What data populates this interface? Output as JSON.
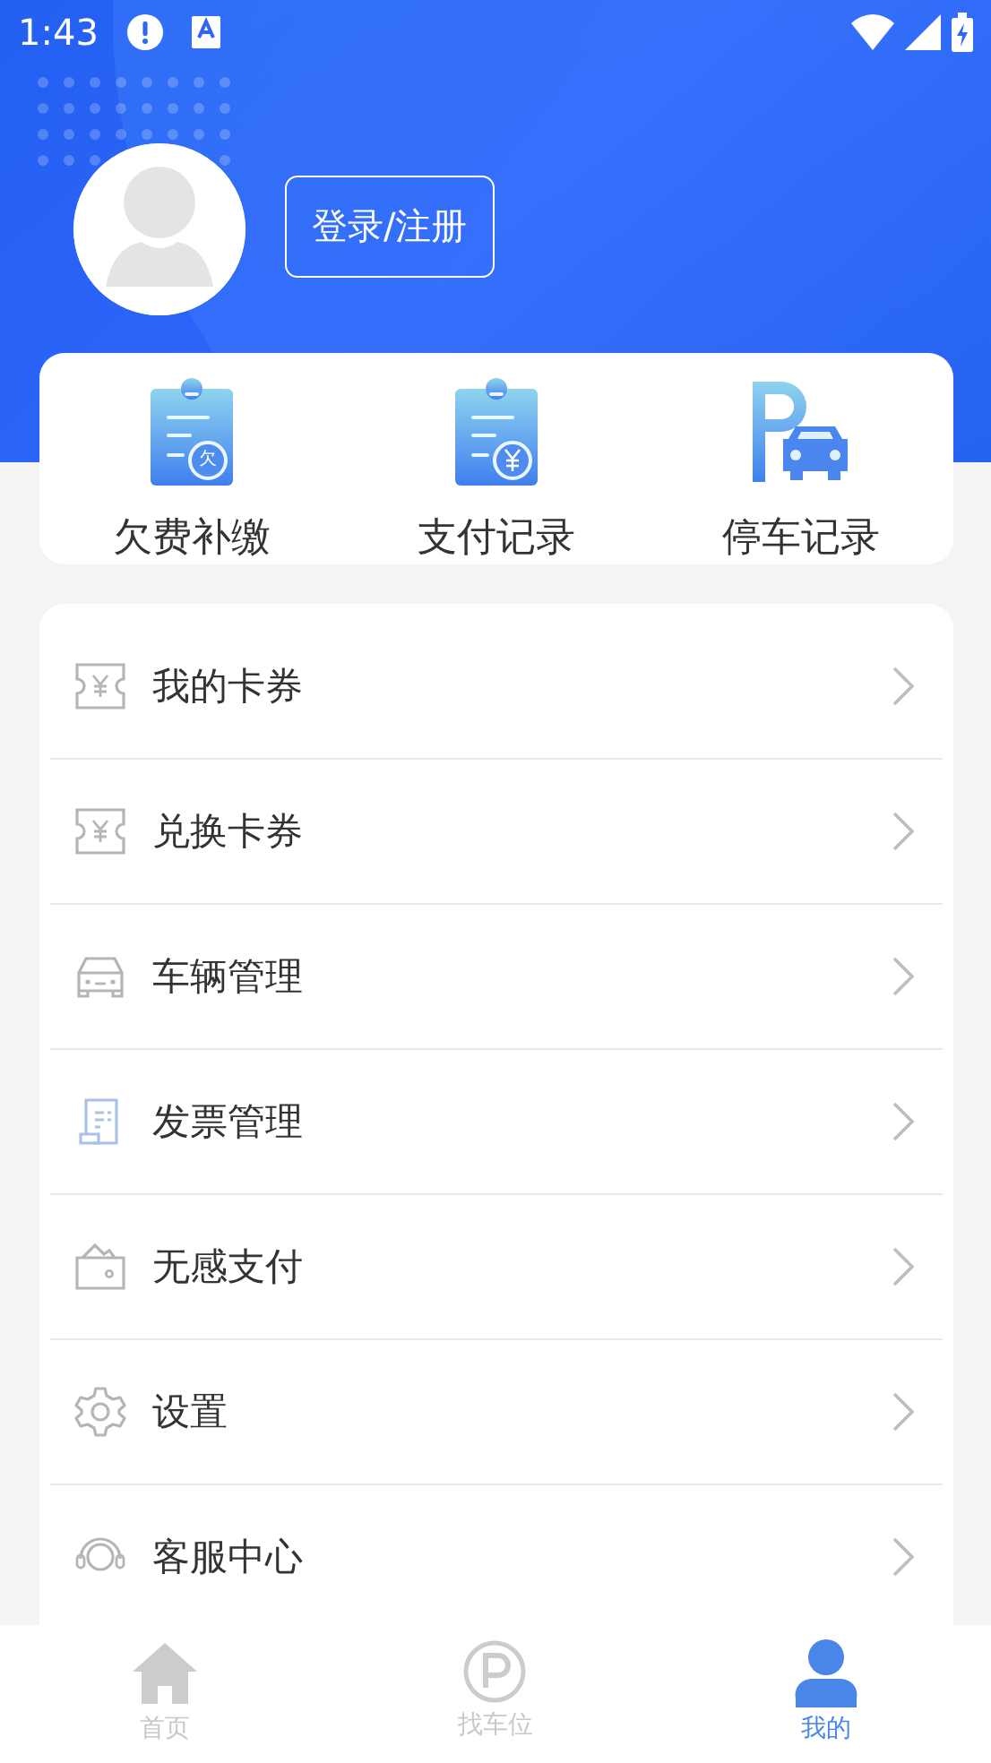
{
  "status_bar": {
    "time": "1:43"
  },
  "profile": {
    "login_button": "登录/注册"
  },
  "shortcuts": [
    {
      "label": "欠费补缴",
      "kind": "arrears",
      "glyph": "欠"
    },
    {
      "label": "支付记录",
      "kind": "payment"
    },
    {
      "label": "停车记录",
      "kind": "parking"
    }
  ],
  "menu": [
    {
      "label": "我的卡券",
      "kind": "coupon"
    },
    {
      "label": "兑换卡券",
      "kind": "coupon"
    },
    {
      "label": "车辆管理",
      "kind": "car"
    },
    {
      "label": "发票管理",
      "kind": "invoice"
    },
    {
      "label": "无感支付",
      "kind": "wallet"
    },
    {
      "label": "设置",
      "kind": "settings"
    },
    {
      "label": "客服中心",
      "kind": "support"
    }
  ],
  "tab_bar": [
    {
      "label": "首页",
      "kind": "home",
      "selected": false
    },
    {
      "label": "找车位",
      "kind": "parking",
      "selected": false
    },
    {
      "label": "我的",
      "kind": "profile",
      "selected": true
    }
  ]
}
